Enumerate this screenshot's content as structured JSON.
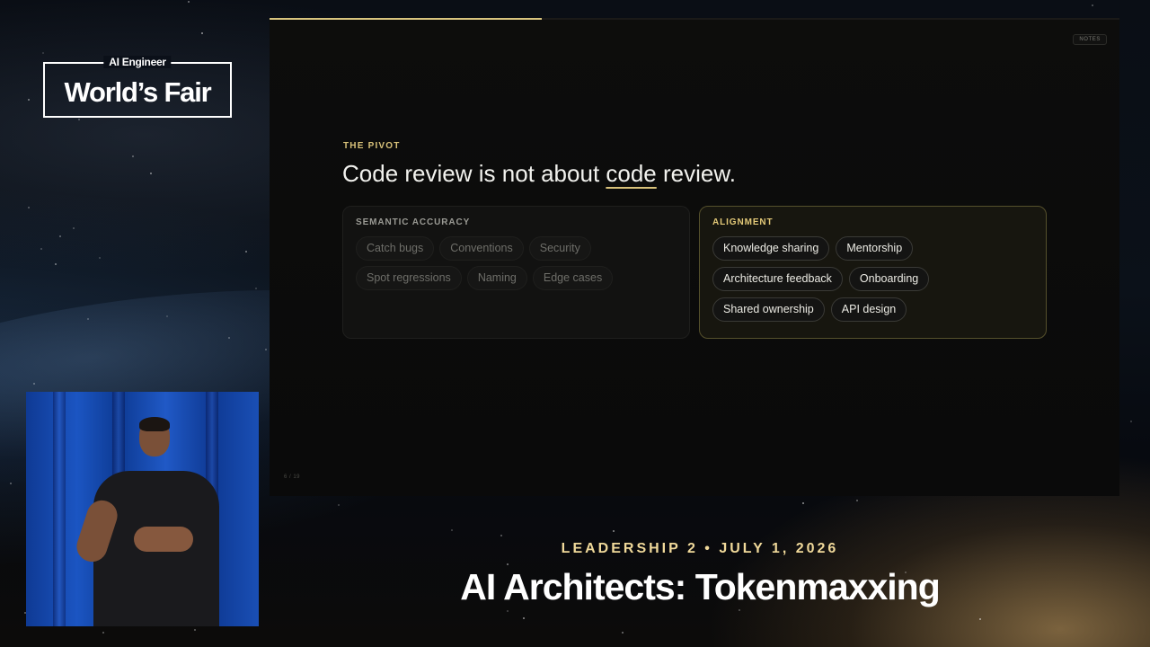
{
  "logo": {
    "top": "AI Engineer",
    "main": "World’s Fair"
  },
  "slide": {
    "notes_label": "NOTES",
    "progress": 0.32,
    "eyebrow": "THE PIVOT",
    "headline": {
      "before": "Code review is not about ",
      "emphasis": "code",
      "after": " review."
    },
    "left_card": {
      "title": "SEMANTIC ACCURACY",
      "chips": [
        "Catch bugs",
        "Conventions",
        "Security",
        "Spot regressions",
        "Naming",
        "Edge cases"
      ]
    },
    "right_card": {
      "title": "ALIGNMENT",
      "chips": [
        "Knowledge sharing",
        "Mentorship",
        "Architecture feedback",
        "Onboarding",
        "Shared ownership",
        "API design"
      ]
    },
    "page_number": "6 / 19"
  },
  "lower_third": {
    "event": "LEADERSHIP 2 • JULY 1, 2026",
    "title": "AI Architects: Tokenmaxxing"
  },
  "colors": {
    "accent": "#d9c27a",
    "slide_bg": "#0b0b0a",
    "alignment_border": "#55502c"
  }
}
